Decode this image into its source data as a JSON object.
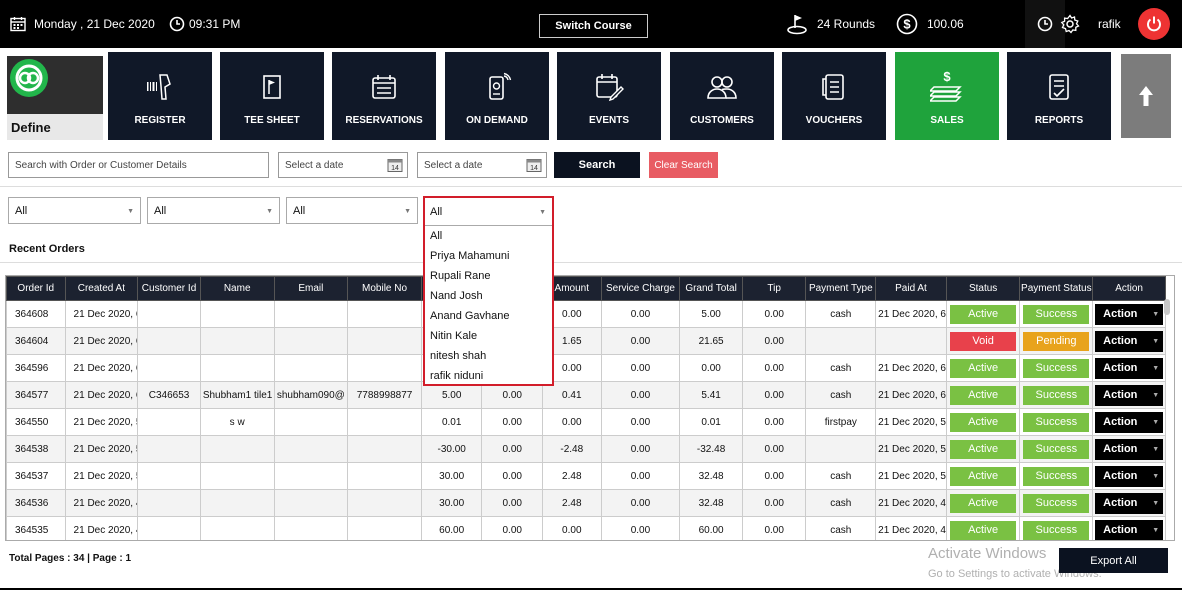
{
  "topbar": {
    "date": "Monday , 21 Dec 2020",
    "time": "09:31 PM",
    "switch_course": "Switch Course",
    "rounds": "24 Rounds",
    "balance": "100.06",
    "user": "rafik"
  },
  "define": {
    "label": "Define"
  },
  "nav": [
    "REGISTER",
    "TEE SHEET",
    "RESERVATIONS",
    "ON DEMAND",
    "EVENTS",
    "CUSTOMERS",
    "VOUCHERS",
    "SALES",
    "REPORTS"
  ],
  "filters": {
    "search_placeholder": "Search with Order or Customer Details",
    "date1_placeholder": "Select a date",
    "date2_placeholder": "Select a date",
    "search_btn": "Search",
    "clear_btn": "Clear Search",
    "sel1": "All",
    "sel2": "All",
    "sel3": "All",
    "sel4": "All"
  },
  "dropdown": {
    "options": [
      "All",
      "Priya Mahamuni",
      "Rupali Rane",
      "Nand Josh",
      "Anand Gavhane",
      "Nitin Kale",
      "nitesh shah",
      "rafik niduni"
    ]
  },
  "recent_orders_title": "Recent Orders",
  "table": {
    "columns": [
      "Order Id",
      "Created At",
      "Customer Id",
      "Name",
      "Email",
      "Mobile No",
      "",
      "",
      "Amount",
      "Service Charge",
      "Grand Total",
      "Tip",
      "Payment Type",
      "Paid At",
      "Status",
      "Payment Status",
      "Action"
    ],
    "rows": [
      [
        "364608",
        "21 Dec 2020, 6:",
        "",
        "",
        "",
        "",
        "",
        "",
        "0.00",
        "0.00",
        "5.00",
        "0.00",
        "cash",
        "21 Dec 2020, 6:",
        "Active",
        "Success",
        "Action"
      ],
      [
        "364604",
        "21 Dec 2020, 6:",
        "",
        "",
        "",
        "",
        "",
        "",
        "1.65",
        "0.00",
        "21.65",
        "0.00",
        "",
        "",
        "Void",
        "Pending",
        "Action"
      ],
      [
        "364596",
        "21 Dec 2020, 6:",
        "",
        "",
        "",
        "",
        "",
        "",
        "0.00",
        "0.00",
        "0.00",
        "0.00",
        "cash",
        "21 Dec 2020, 6:",
        "Active",
        "Success",
        "Action"
      ],
      [
        "364577",
        "21 Dec 2020, 6:",
        "C346653",
        "Shubham1 tile1",
        "shubham090@",
        "7788998877",
        "5.00",
        "0.00",
        "0.41",
        "0.00",
        "5.41",
        "0.00",
        "cash",
        "21 Dec 2020, 6:",
        "Active",
        "Success",
        "Action"
      ],
      [
        "364550",
        "21 Dec 2020, 5:",
        "",
        "s w",
        "",
        "",
        "0.01",
        "0.00",
        "0.00",
        "0.00",
        "0.01",
        "0.00",
        "firstpay",
        "21 Dec 2020, 5:",
        "Active",
        "Success",
        "Action"
      ],
      [
        "364538",
        "21 Dec 2020, 5:",
        "",
        "",
        "",
        "",
        "-30.00",
        "0.00",
        "-2.48",
        "0.00",
        "-32.48",
        "0.00",
        "",
        "21 Dec 2020, 5:",
        "Active",
        "Success",
        "Action"
      ],
      [
        "364537",
        "21 Dec 2020, 5:",
        "",
        "",
        "",
        "",
        "30.00",
        "0.00",
        "2.48",
        "0.00",
        "32.48",
        "0.00",
        "cash",
        "21 Dec 2020, 5:",
        "Active",
        "Success",
        "Action"
      ],
      [
        "364536",
        "21 Dec 2020, 4:",
        "",
        "",
        "",
        "",
        "30.00",
        "0.00",
        "2.48",
        "0.00",
        "32.48",
        "0.00",
        "cash",
        "21 Dec 2020, 4:",
        "Active",
        "Success",
        "Action"
      ],
      [
        "364535",
        "21 Dec 2020, 4:",
        "",
        "",
        "",
        "",
        "60.00",
        "0.00",
        "0.00",
        "0.00",
        "60.00",
        "0.00",
        "cash",
        "21 Dec 2020, 4:",
        "Active",
        "Success",
        "Action"
      ]
    ]
  },
  "footer": {
    "pages": "Total Pages : 34 | Page : 1",
    "export": "Export All",
    "watermark1": "Activate Windows",
    "watermark2": "Go to Settings to activate Windows."
  },
  "colors": {
    "sales_green": "#1fa33c",
    "void_red": "#e8414b",
    "pending_orange": "#e8a31c",
    "active_green": "#7ac143",
    "highlight_red": "#d21d2a"
  }
}
